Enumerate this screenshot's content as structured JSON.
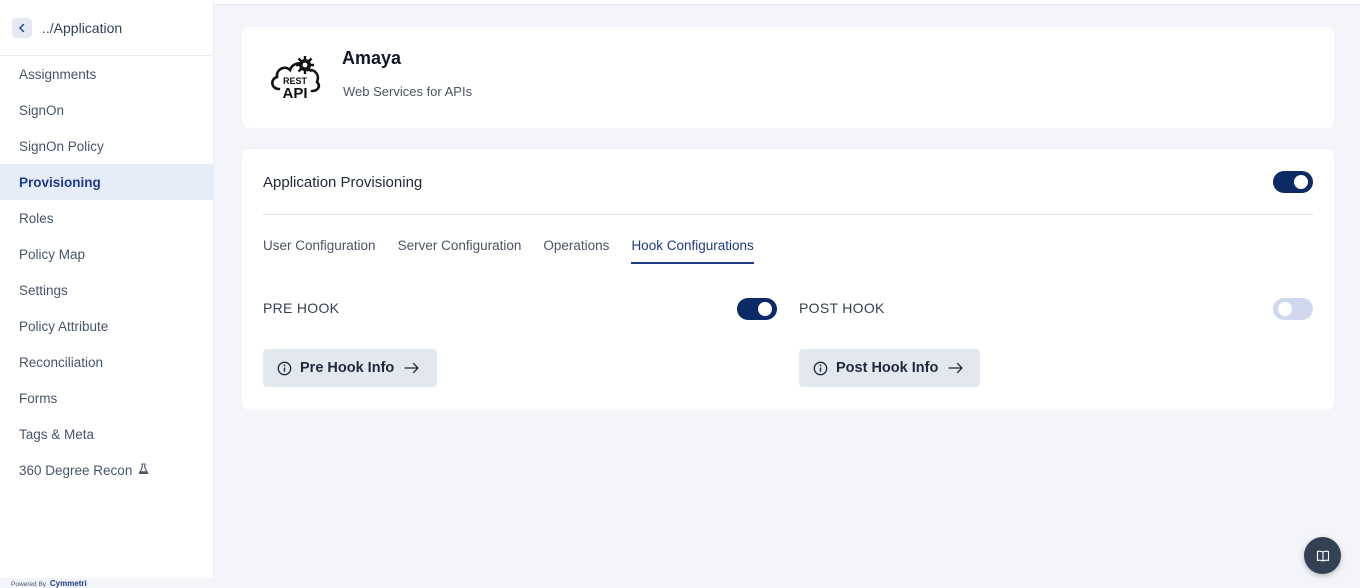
{
  "sidebar": {
    "breadcrumb": "../Application",
    "items": [
      {
        "label": "Assignments"
      },
      {
        "label": "SignOn"
      },
      {
        "label": "SignOn Policy"
      },
      {
        "label": "Provisioning",
        "active": true
      },
      {
        "label": "Roles"
      },
      {
        "label": "Policy Map"
      },
      {
        "label": "Settings"
      },
      {
        "label": "Policy Attribute"
      },
      {
        "label": "Reconciliation"
      },
      {
        "label": "Forms"
      },
      {
        "label": "Tags & Meta"
      },
      {
        "label": "360 Degree Recon",
        "icon": "flask-icon"
      }
    ],
    "footer": {
      "powered_by": "Powered By",
      "brand": "Cymmetri"
    }
  },
  "app": {
    "name": "Amaya",
    "description": "Web Services for APIs",
    "logo_text_top": "REST",
    "logo_text_bottom": "API"
  },
  "provisioning": {
    "title": "Application Provisioning",
    "enabled": true,
    "tabs": [
      {
        "label": "User Configuration"
      },
      {
        "label": "Server Configuration"
      },
      {
        "label": "Operations"
      },
      {
        "label": "Hook Configurations",
        "active": true
      }
    ],
    "pre_hook": {
      "label": "PRE HOOK",
      "enabled": true,
      "button_label": "Pre Hook Info"
    },
    "post_hook": {
      "label": "POST HOOK",
      "enabled": false,
      "button_label": "Post Hook Info"
    }
  },
  "colors": {
    "accent": "#0b2a66",
    "active_nav_bg": "#e6ecf8",
    "page_bg": "#f3f5fa"
  }
}
